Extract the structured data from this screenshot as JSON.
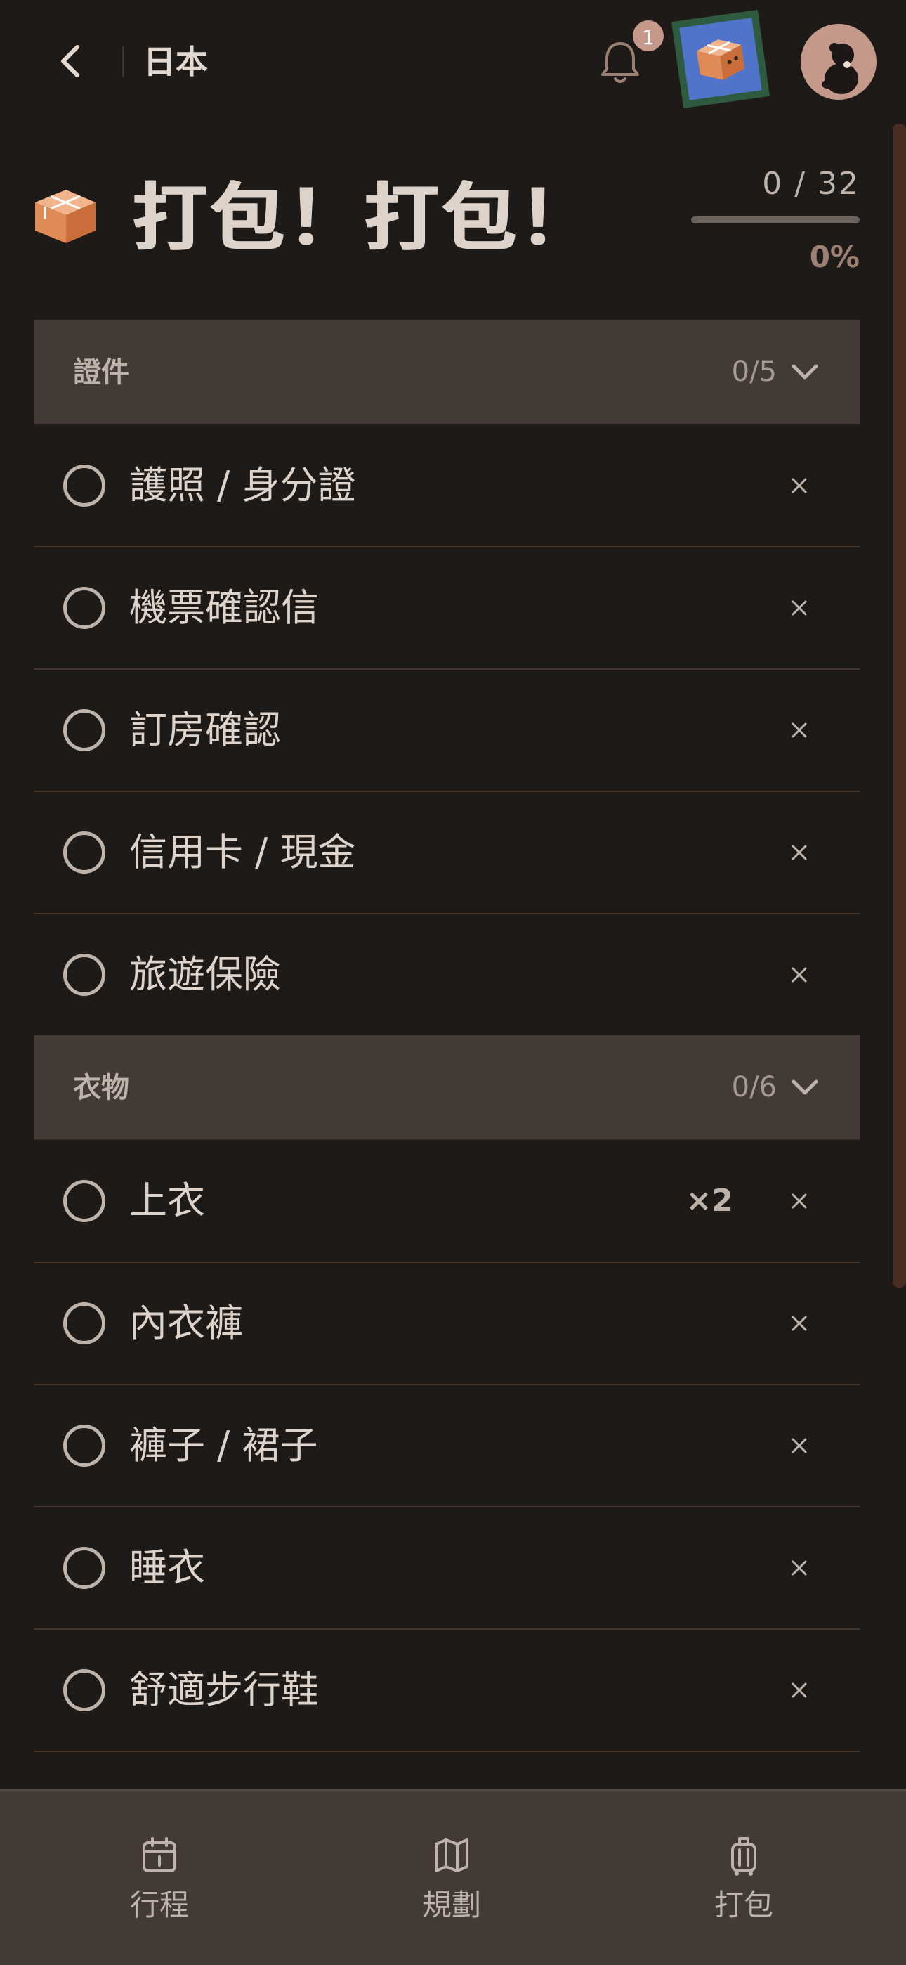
{
  "header": {
    "back_icon": "chevron-left-icon",
    "title": "日本",
    "notification_icon": "bell-icon",
    "notification_count": "1",
    "sticker_icon": "package-box-sticker",
    "avatar_icon": "user-avatar"
  },
  "hero": {
    "icon": "package-box-icon",
    "title": "打包！打包！",
    "progress_count": "0 / 32",
    "progress_fraction": 0,
    "progress_percent": "0%"
  },
  "sections": [
    {
      "name": "證件",
      "count": "0/5",
      "items": [
        {
          "label": "護照 / 身分證",
          "qty": ""
        },
        {
          "label": "機票確認信",
          "qty": ""
        },
        {
          "label": "訂房確認",
          "qty": ""
        },
        {
          "label": "信用卡 / 現金",
          "qty": ""
        },
        {
          "label": "旅遊保險",
          "qty": ""
        }
      ]
    },
    {
      "name": "衣物",
      "count": "0/6",
      "items": [
        {
          "label": "上衣",
          "qty": "×2"
        },
        {
          "label": "內衣褲",
          "qty": ""
        },
        {
          "label": "褲子 / 裙子",
          "qty": ""
        },
        {
          "label": "睡衣",
          "qty": ""
        },
        {
          "label": "舒適步行鞋",
          "qty": ""
        }
      ]
    }
  ],
  "bottom_nav": [
    {
      "label": "行程",
      "icon": "calendar-icon"
    },
    {
      "label": "規劃",
      "icon": "map-icon"
    },
    {
      "label": "打包",
      "icon": "luggage-icon"
    }
  ],
  "colors": {
    "background": "#1e1a18",
    "panel": "#433a36",
    "accent": "#c4998a",
    "text": "#ddd3cb",
    "muted": "#bdb3ab",
    "divider": "#4a352d"
  }
}
